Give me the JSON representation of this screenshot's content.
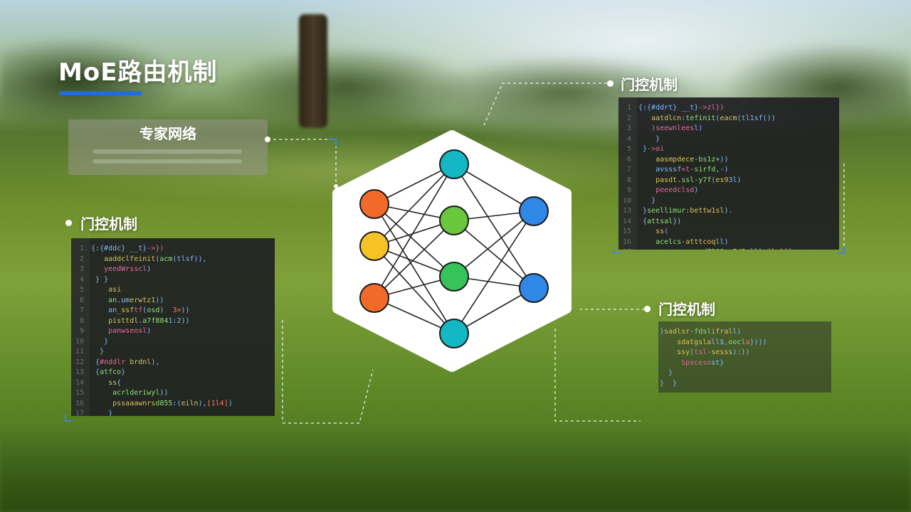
{
  "title": "MoE路由机制",
  "expert_box": {
    "title": "专家网络"
  },
  "gate_labels": [
    "门控机制",
    "门控机制",
    "门控机制"
  ],
  "colors": {
    "accent": "#1e6fd0",
    "node_orange": "#f26a2a",
    "node_yellow": "#f7c324",
    "node_teal": "#14b8c4",
    "node_green": "#6ac63d",
    "node_green2": "#37c25a",
    "node_blue": "#2f87e6",
    "hexagon": "#ffffff"
  },
  "icons": [
    "neural-network-icon"
  ]
}
